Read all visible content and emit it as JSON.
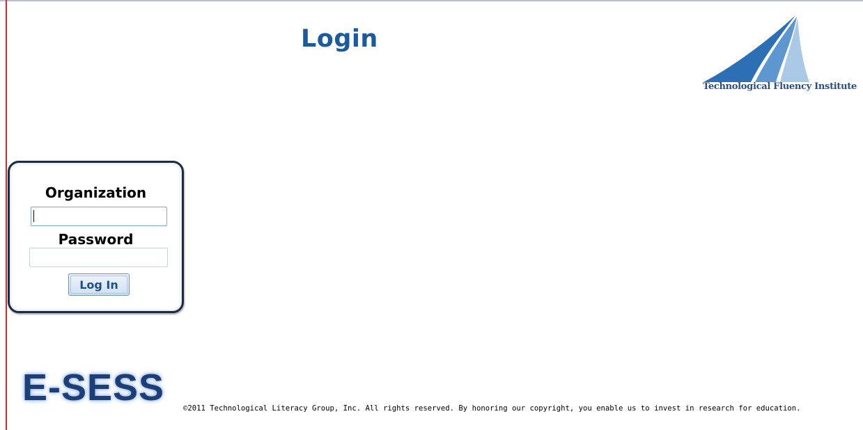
{
  "page": {
    "title": "Login"
  },
  "logo": {
    "text": "Technological Fluency Institute"
  },
  "login_form": {
    "organization_label": "Organization",
    "organization_value": "",
    "password_label": "Password",
    "password_value": "",
    "submit_label": "Log In"
  },
  "footer": {
    "brand": "E-SESS",
    "copyright": "©2011 Technological Literacy Group, Inc. All rights reserved. By honoring our copyright, you enable us to invest in research for education."
  },
  "colors": {
    "title_blue": "#1b5a9c",
    "panel_border": "#1a2a4a",
    "left_rule": "#d8262a",
    "brand_blue": "#1c3f7a"
  }
}
